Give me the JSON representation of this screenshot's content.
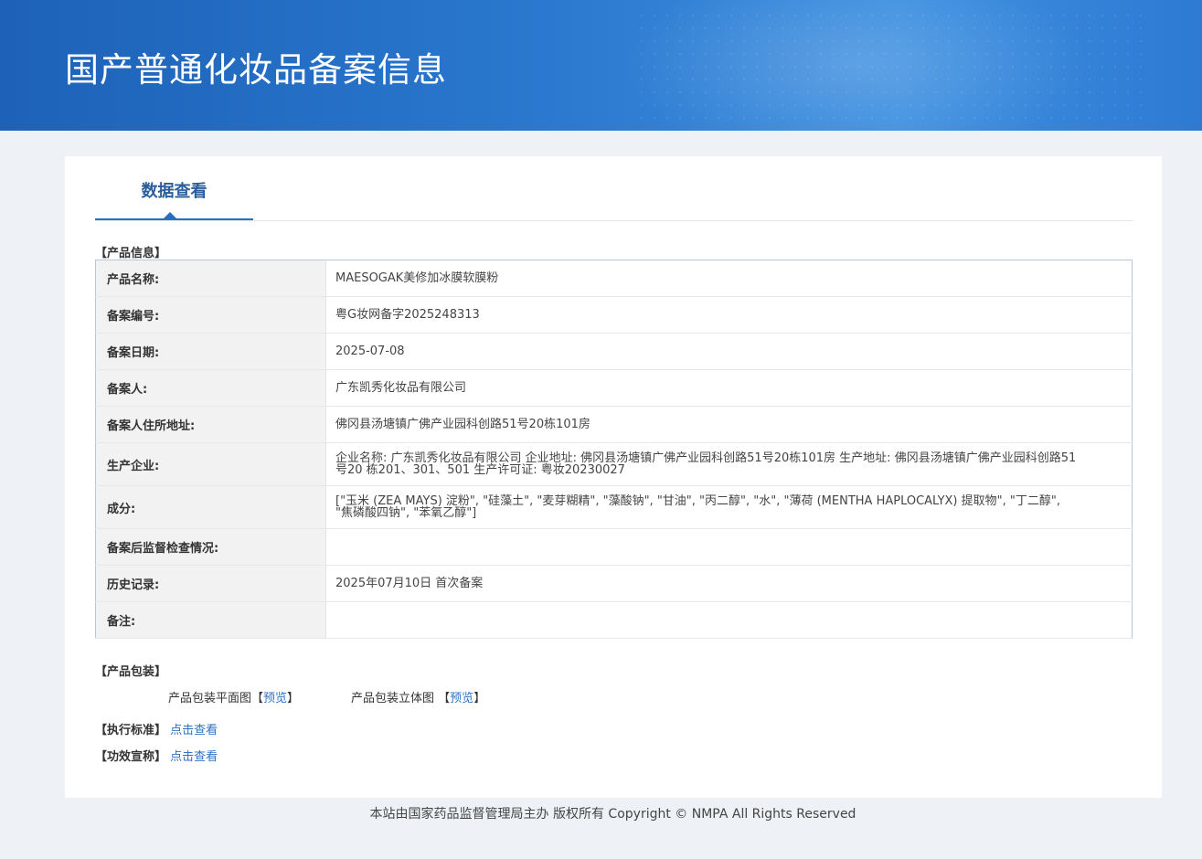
{
  "header": {
    "title": "国产普通化妆品备案信息"
  },
  "tabs": [
    {
      "label": "数据查看"
    }
  ],
  "product_info": {
    "section_label": "【产品信息】",
    "rows": [
      {
        "label": "产品名称:",
        "value": "MAESOGAK美修加冰膜软膜粉"
      },
      {
        "label": "备案编号:",
        "value": "粤G妆网备字2025248313"
      },
      {
        "label": "备案日期:",
        "value": "2025-07-08"
      },
      {
        "label": "备案人:",
        "value": "广东凯秀化妆品有限公司"
      },
      {
        "label": "备案人住所地址:",
        "value": "佛冈县汤塘镇广佛产业园科创路51号20栋101房"
      },
      {
        "label": "生产企业:",
        "value": "企业名称: 广东凯秀化妆品有限公司 企业地址: 佛冈县汤塘镇广佛产业园科创路51号20栋101房 生产地址: 佛冈县汤塘镇广佛产业园科创路51号20 栋201、301、501 生产许可证: 粤妆20230027"
      },
      {
        "label": "成分:",
        "value": "[\"玉米 (ZEA MAYS) 淀粉\", \"硅藻土\", \"麦芽糊精\", \"藻酸钠\", \"甘油\", \"丙二醇\", \"水\", \"薄荷 (MENTHA HAPLOCALYX) 提取物\", \"丁二醇\", \"焦磷酸四钠\", \"苯氧乙醇\"]"
      },
      {
        "label": "备案后监督检查情况:",
        "value": ""
      },
      {
        "label": "历史记录:",
        "value": "2025年07月10日 首次备案"
      },
      {
        "label": "备注:",
        "value": ""
      }
    ]
  },
  "packaging": {
    "section_label": "【产品包装】",
    "flat_label": "产品包装平面图",
    "flat_link": "预览",
    "solid_label": "产品包装立体图",
    "solid_link": "预览",
    "bracket_open": "【",
    "bracket_close": "】"
  },
  "standard": {
    "label": "【执行标准】",
    "link": "点击查看"
  },
  "efficacy": {
    "label": "【功效宣称】",
    "link": "点击查看"
  },
  "footer": {
    "text": "本站由国家药品监督管理局主办 版权所有 Copyright © NMPA All Rights Reserved"
  }
}
